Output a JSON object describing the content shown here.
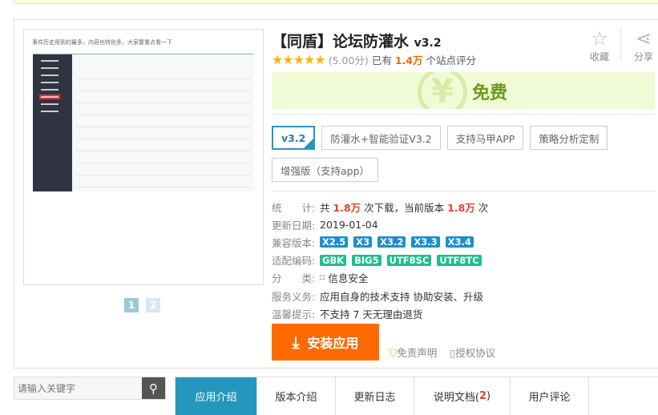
{
  "screenshot": {
    "caption": "事件历史用到的最多，内容也特别多，大家要重点看一下"
  },
  "pager": [
    "1",
    "2"
  ],
  "app": {
    "title": "【同盾】论坛防灌水",
    "version": "v3.2",
    "stars": 5,
    "score": "(5.00分)",
    "rated_prefix": "已有",
    "rated_count": "1.4万",
    "rated_suffix": "个站点评分"
  },
  "actions": {
    "favorite": "收藏",
    "share": "分享"
  },
  "price": {
    "label": "免费",
    "icon": "¥"
  },
  "versions": [
    "v3.2",
    "防灌水+智能验证V3.2",
    "支持马甲APP",
    "策略分析定制",
    "增强版（支持app）"
  ],
  "info": {
    "stats_label": "统　　计:",
    "stats_pre": "共",
    "downloads": "1.8万",
    "stats_mid": "次下载，当前版本",
    "current": "1.8万",
    "stats_post": "次",
    "date_label": "更新日期:",
    "date": "2019-01-04",
    "compat_label": "兼容版本:",
    "compat": [
      "X2.5",
      "X3",
      "X3.2",
      "X3.3",
      "X3.4"
    ],
    "encoding_label": "适配编码:",
    "encoding": [
      "GBK",
      "BIG5",
      "UTF8SC",
      "UTF8TC"
    ],
    "category_label": "分　　类:",
    "category": "信息安全",
    "service_label": "服务义务:",
    "service": "应用自身的技术支持  协助安装、升级",
    "tip_label": "温馨提示:",
    "tip": "不支持 7 天无理由退货"
  },
  "install": "安装应用",
  "links": {
    "disclaimer": "免责声明",
    "license": "授权协议"
  },
  "search": {
    "placeholder": "请输入关键字"
  },
  "tabs": [
    {
      "label": "应用介绍"
    },
    {
      "label": "版本介绍"
    },
    {
      "label": "更新日志"
    },
    {
      "label": "说明文档(",
      "count": "2",
      "close": ")"
    },
    {
      "label": "用户评论"
    }
  ],
  "colors": {
    "accent": "#2397be",
    "install": "#ff6a00",
    "free": "#6a9a1f",
    "highlight": "#e8402e"
  }
}
